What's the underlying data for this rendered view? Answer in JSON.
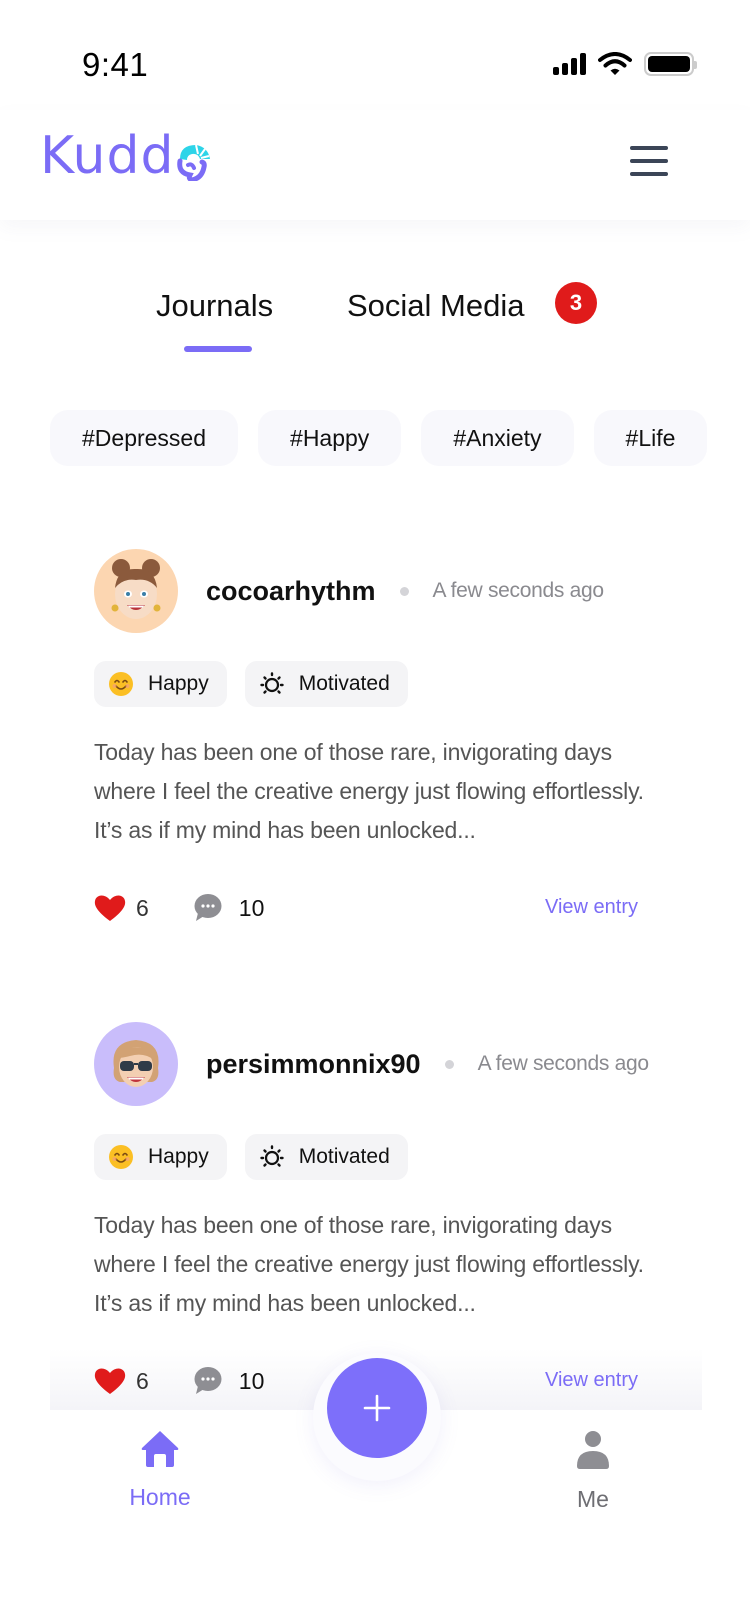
{
  "status_bar": {
    "time": "9:41"
  },
  "header": {
    "logo_text": "Kudd",
    "brand_color": "#7b6cf6",
    "logo_accent_color": "#2dd4e8",
    "menu_icon": "hamburger-menu-icon"
  },
  "tabs": [
    {
      "label": "Journals",
      "active": true
    },
    {
      "label": "Social Media",
      "active": false,
      "badge": "3"
    }
  ],
  "hashtags": [
    "#Depressed",
    "#Happy",
    "#Anxiety",
    "#Life"
  ],
  "posts": [
    {
      "username": "cocoarhythm",
      "time": "A few seconds ago",
      "avatar": "memoji-girl-buns",
      "moods": [
        {
          "icon": "smiling-face-emoji",
          "label": "Happy"
        },
        {
          "icon": "sun-icon",
          "label": "Motivated"
        }
      ],
      "text": "Today has been one of those rare, invigorating days where I feel the creative energy just flowing effortlessly. It’s as if my mind has been unlocked...",
      "likes": "6",
      "comments": "10",
      "view_label": "View entry"
    },
    {
      "username": "persimmonnix90",
      "time": "A few seconds ago",
      "avatar": "memoji-woman-sunglasses",
      "moods": [
        {
          "icon": "smiling-face-emoji",
          "label": "Happy"
        },
        {
          "icon": "sun-icon",
          "label": "Motivated"
        }
      ],
      "text": "Today has been one of those rare, invigorating days where I feel the creative energy just flowing effortlessly. It’s as if my mind has been unlocked...",
      "likes": "6",
      "comments": "10",
      "view_label": "View entry"
    }
  ],
  "bottom_nav": {
    "items": [
      {
        "label": "Home",
        "icon": "home-icon",
        "active": true
      },
      {
        "label": "Me",
        "icon": "person-icon",
        "active": false
      }
    ],
    "fab_icon": "plus-icon"
  },
  "colors": {
    "accent": "#7b6cf6",
    "badge": "#e01b1b",
    "like": "#e01b1b",
    "muted_text": "#8a8a8f"
  }
}
